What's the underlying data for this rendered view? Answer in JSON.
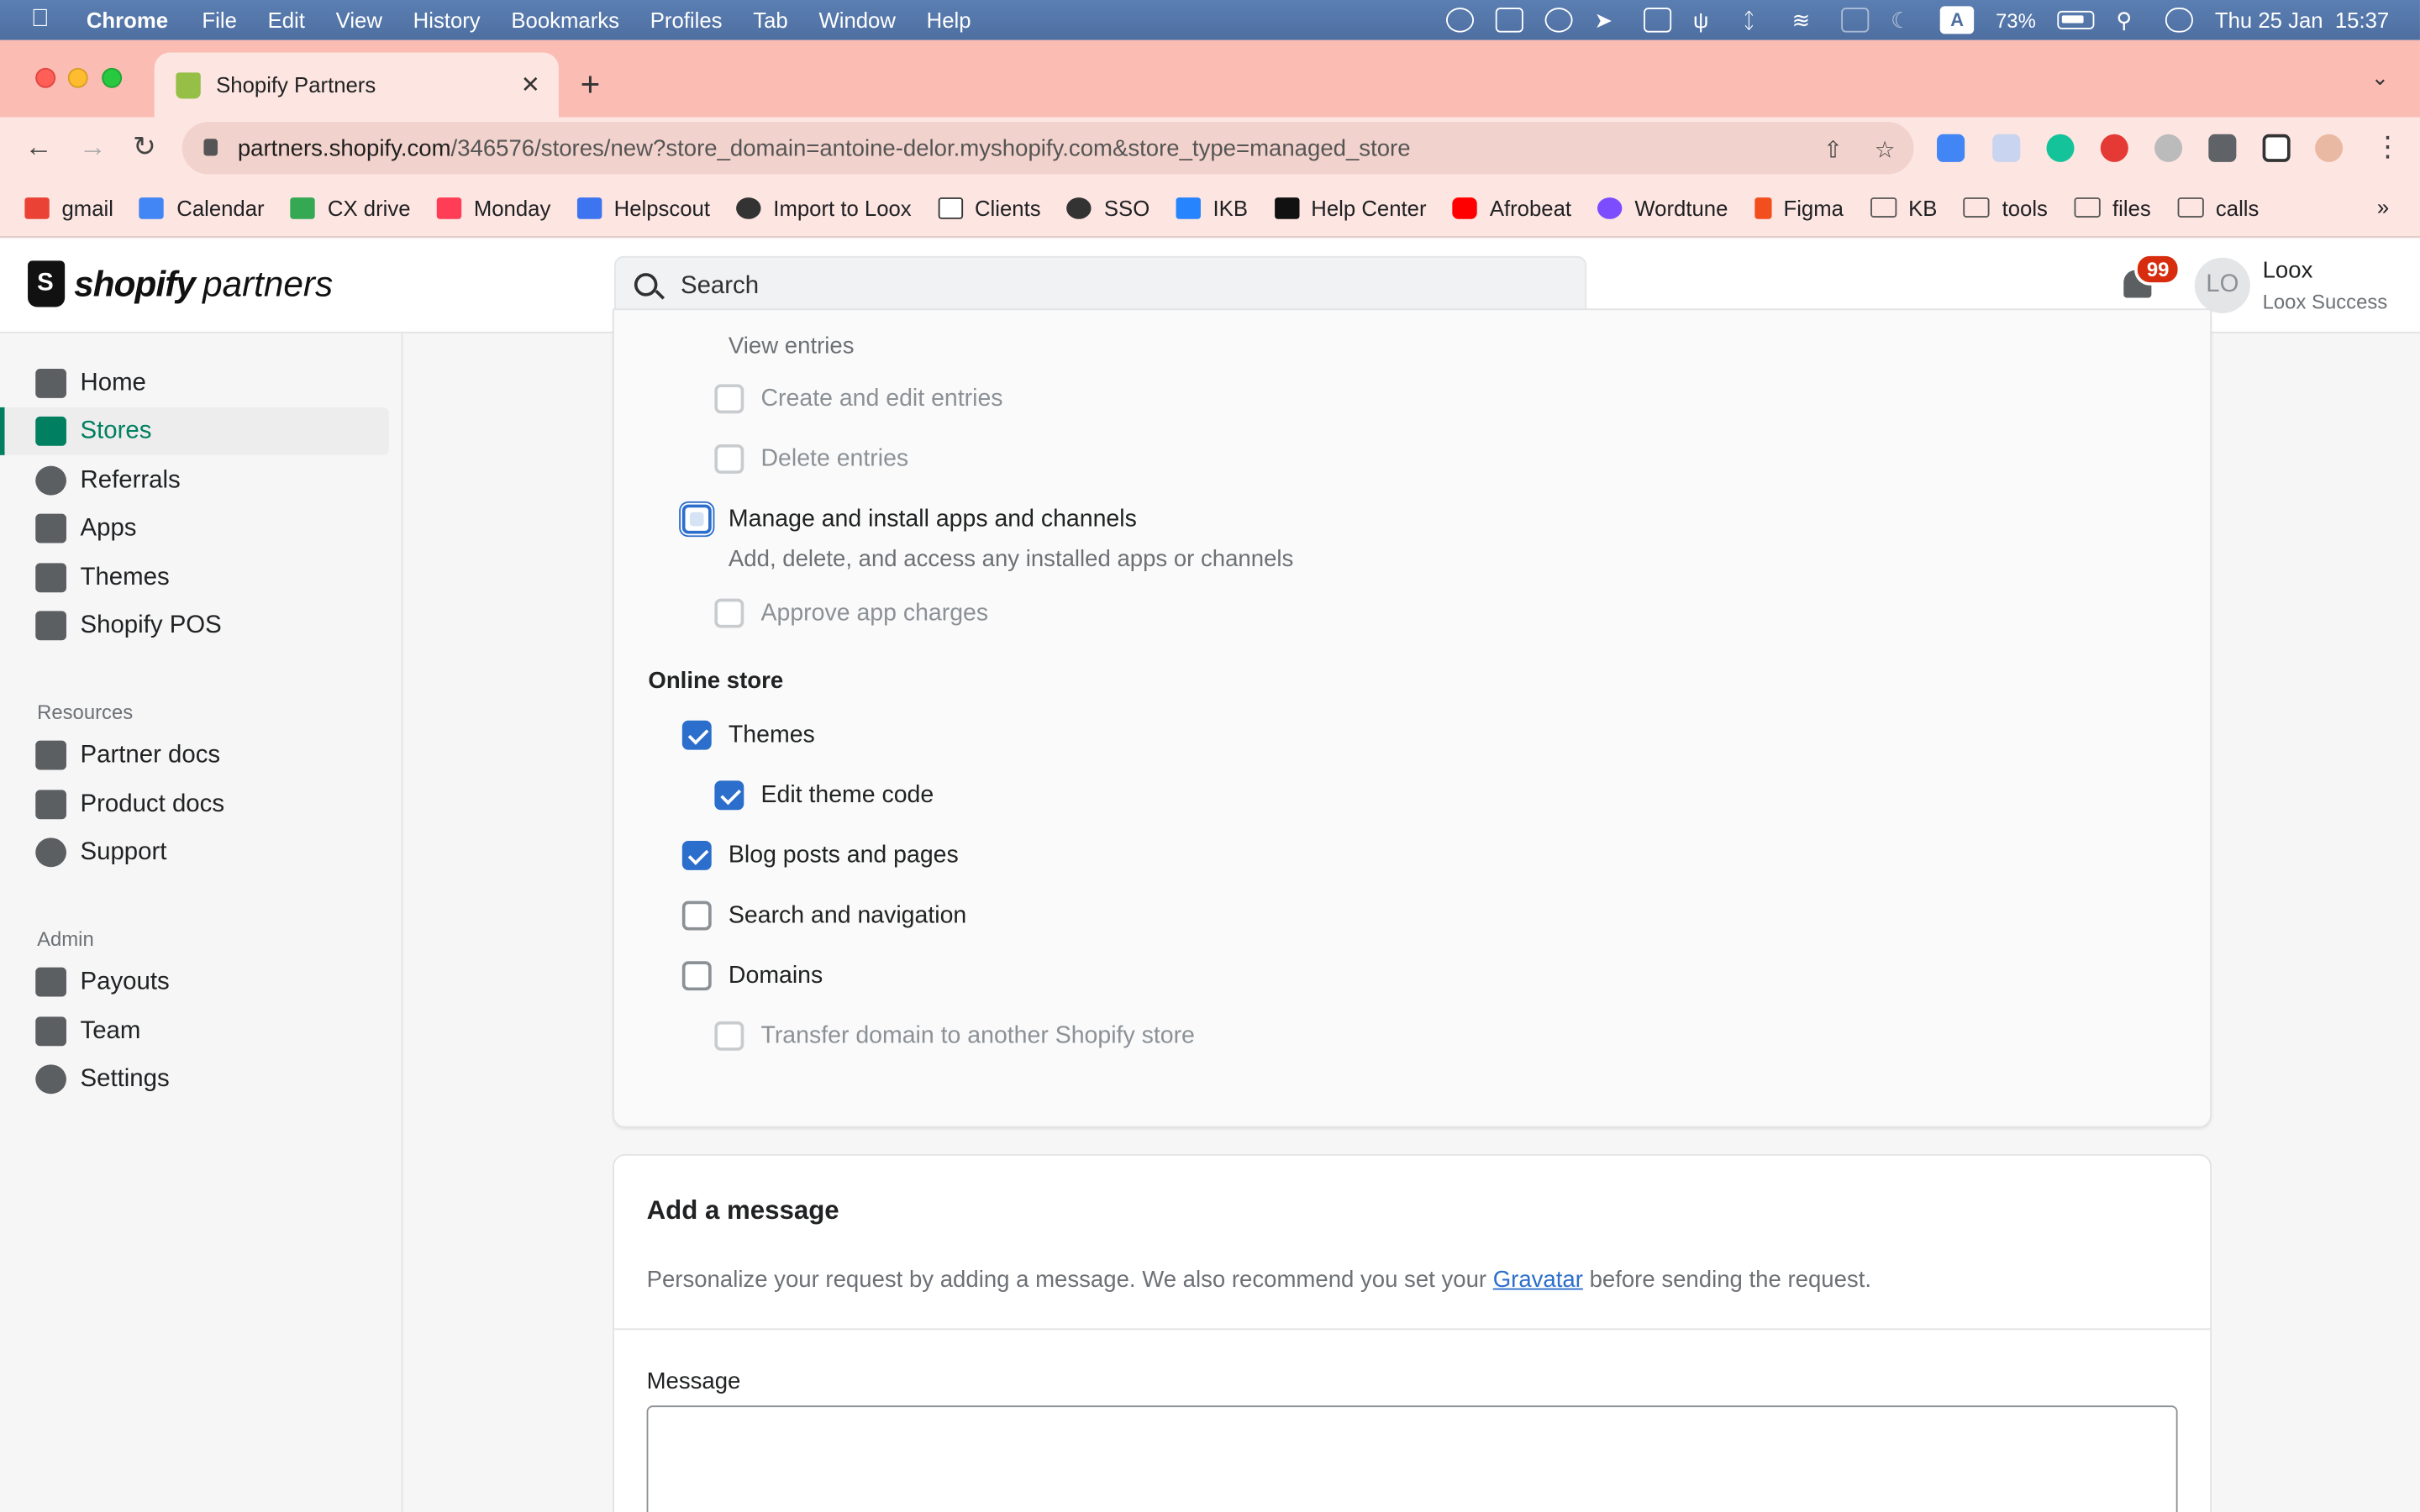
{
  "menubar": {
    "app": "Chrome",
    "items": [
      "File",
      "Edit",
      "View",
      "History",
      "Bookmarks",
      "Profiles",
      "Tab",
      "Window",
      "Help"
    ],
    "battery": "73%",
    "datetime": "Thu 25 Jan  15:37",
    "input_badge": "A"
  },
  "browser": {
    "tab_title": "Shopify Partners",
    "url_host": "partners.shopify.com",
    "url_path": "/346576/stores/new?store_domain=antoine-delor.myshopify.com&store_type=managed_store",
    "bookmarks": [
      {
        "label": "gmail",
        "color": "#ea4335"
      },
      {
        "label": "Calendar",
        "color": "#4285f4"
      },
      {
        "label": "CX drive",
        "color": "#34a853"
      },
      {
        "label": "Monday",
        "color": "#ff3d57"
      },
      {
        "label": "Helpscout",
        "color": "#3d74f0"
      },
      {
        "label": "Import to Loox",
        "color": "#333333"
      },
      {
        "label": "Clients",
        "color": "#333333"
      },
      {
        "label": "SSO",
        "color": "#333333"
      },
      {
        "label": "IKB",
        "color": "#2684ff"
      },
      {
        "label": "Help Center",
        "color": "#111111"
      },
      {
        "label": "Afrobeat",
        "color": "#ff0000"
      },
      {
        "label": "Wordtune",
        "color": "#7b4dff"
      },
      {
        "label": "Figma",
        "color": "#f24e1e"
      }
    ],
    "bookmark_folders": [
      "KB",
      "tools",
      "files",
      "calls"
    ],
    "bookmarks_more": "»"
  },
  "header": {
    "logo_bold": "shopify",
    "logo_light": "partners",
    "search_placeholder": "Search",
    "notifications": "99",
    "avatar_initials": "LO",
    "user_name": "Loox",
    "user_org": "Loox Success"
  },
  "sidebar": {
    "main": [
      {
        "label": "Home",
        "active": false
      },
      {
        "label": "Stores",
        "active": true
      },
      {
        "label": "Referrals",
        "active": false
      },
      {
        "label": "Apps",
        "active": false
      },
      {
        "label": "Themes",
        "active": false
      },
      {
        "label": "Shopify POS",
        "active": false
      }
    ],
    "resources_heading": "Resources",
    "resources": [
      "Partner docs",
      "Product docs",
      "Support"
    ],
    "admin_heading": "Admin",
    "admin": [
      "Payouts",
      "Team",
      "Settings"
    ]
  },
  "permissions": {
    "view_entries_hint": "View entries",
    "create_edit_entries": "Create and edit entries",
    "delete_entries": "Delete entries",
    "manage_apps": "Manage and install apps and channels",
    "manage_apps_hint": "Add, delete, and access any installed apps or channels",
    "approve_charges": "Approve app charges",
    "online_store_heading": "Online store",
    "themes": "Themes",
    "edit_theme_code": "Edit theme code",
    "blog_posts": "Blog posts and pages",
    "search_nav": "Search and navigation",
    "domains": "Domains",
    "transfer_domain": "Transfer domain to another Shopify store"
  },
  "message_card": {
    "title": "Add a message",
    "desc_before": "Personalize your request by adding a message. We also recommend you set your ",
    "desc_link": "Gravatar",
    "desc_after": " before sending the request.",
    "field_label": "Message"
  }
}
